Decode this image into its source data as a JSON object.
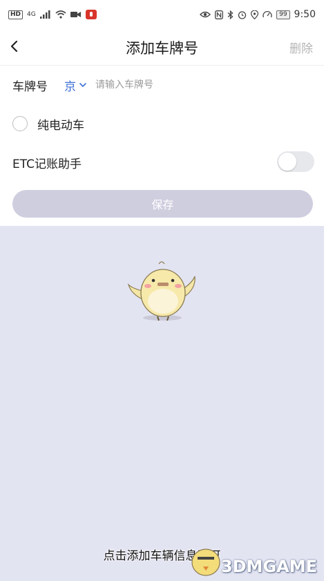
{
  "status_bar": {
    "left_tag": "HD",
    "network": "4G",
    "battery": "99",
    "time": "9:50"
  },
  "header": {
    "title": "添加车牌号",
    "delete_label": "删除"
  },
  "form": {
    "plate_label": "车牌号",
    "province": "京",
    "plate_placeholder": "请输入车牌号",
    "ev_label": "纯电动车",
    "etc_label": "ETC记账助手",
    "save_label": "保存"
  },
  "caption": "点击添加车辆信息即可",
  "watermark": "3DMGAME",
  "colors": {
    "accent": "#3b6fd3",
    "background": "#e3e4f2",
    "save_button": "#cfcedf"
  }
}
